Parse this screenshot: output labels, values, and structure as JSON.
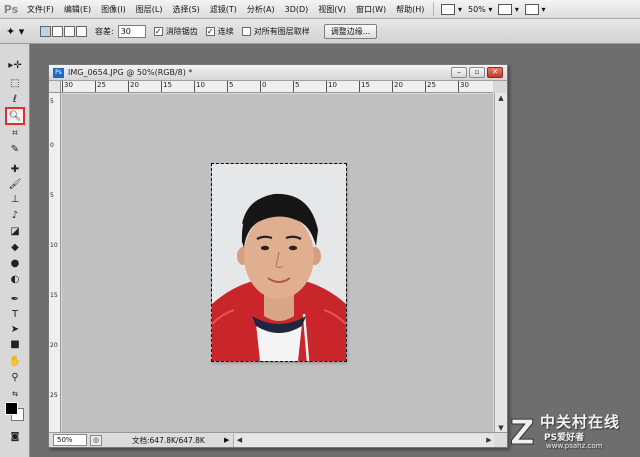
{
  "app": {
    "logo": "Ps"
  },
  "menubar": {
    "items": [
      "文件(F)",
      "编辑(E)",
      "图像(I)",
      "图层(L)",
      "选择(S)",
      "滤镜(T)",
      "分析(A)",
      "3D(D)",
      "视图(V)",
      "窗口(W)",
      "帮助(H)"
    ],
    "zoom": "50%"
  },
  "options": {
    "tolerance_label": "容差:",
    "tolerance_value": "30",
    "antialias_label": "消除锯齿",
    "antialias_checked": true,
    "contiguous_label": "连续",
    "contiguous_checked": true,
    "sample_all_label": "对所有图层取样",
    "sample_all_checked": false,
    "refine_edge_label": "调整边缘..."
  },
  "tools": {
    "active": "magic-wand",
    "icons": [
      "move-icon",
      "marquee-icon",
      "lasso-icon",
      "magic-wand-icon",
      "crop-icon",
      "eyedropper-icon",
      "spot-healing-icon",
      "brush-icon",
      "clone-stamp-icon",
      "history-brush-icon",
      "eraser-icon",
      "paint-bucket-icon",
      "blur-icon",
      "dodge-icon",
      "pen-icon",
      "type-icon",
      "path-selection-icon",
      "shape-icon",
      "3d-rotate-icon",
      "3d-orbit-icon",
      "hand-icon",
      "zoom-icon"
    ],
    "foreground_color": "#000000",
    "background_color": "#ffffff"
  },
  "document": {
    "title": "IMG_0654.JPG @ 50%(RGB/8) *",
    "ruler_h": [
      "30",
      "25",
      "20",
      "15",
      "10",
      "5",
      "0",
      "5",
      "10",
      "15",
      "20",
      "25",
      "30"
    ],
    "ruler_v": [
      "5",
      "0",
      "5",
      "10",
      "15",
      "20",
      "25"
    ],
    "zoom": "50%",
    "doc_info": "文档:647.8K/647.8K",
    "canvas_color": "#c0c0c0"
  },
  "watermark": {
    "cn": "中关村在线",
    "site": "PS爱好者",
    "url": "www.psahz.com"
  }
}
